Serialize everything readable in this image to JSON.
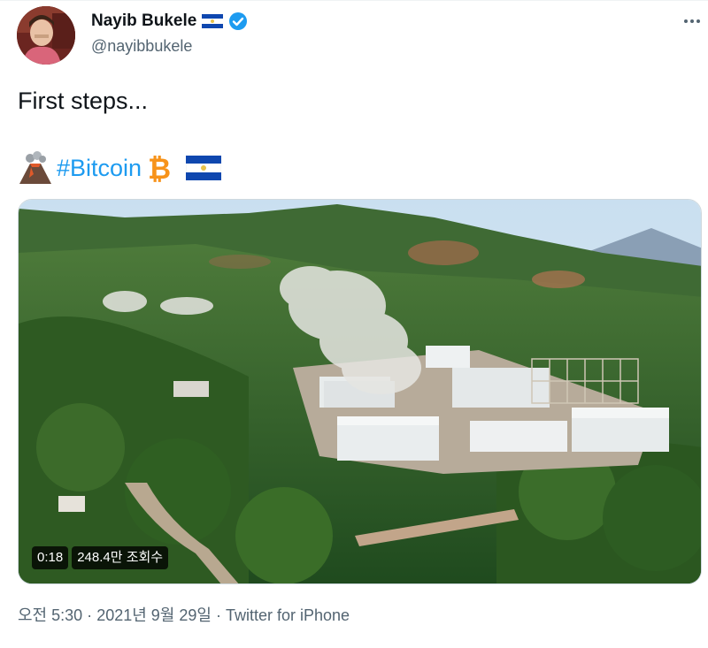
{
  "author": {
    "display_name": "Nayib Bukele",
    "handle": "@nayibbukele",
    "verified": true,
    "flag_icon": "el-salvador-flag-icon"
  },
  "tweet": {
    "text_line1": "First steps...",
    "hashtag": "#Bitcoin",
    "emojis": [
      "volcano-emoji",
      "bitcoin-emoji",
      "el-salvador-flag-emoji"
    ]
  },
  "media": {
    "type": "video",
    "description_icon": "geothermal-plant-video-thumbnail",
    "duration": "0:18",
    "views": "248.4만 조회수"
  },
  "meta": {
    "time": "오전 5:30",
    "separator": "·",
    "date": "2021년 9월 29일",
    "source": "Twitter for iPhone"
  },
  "colors": {
    "accent": "#1d9bf0",
    "secondary_text": "#536471",
    "verified": "#1d9bf0",
    "bitcoin": "#f7931a"
  }
}
